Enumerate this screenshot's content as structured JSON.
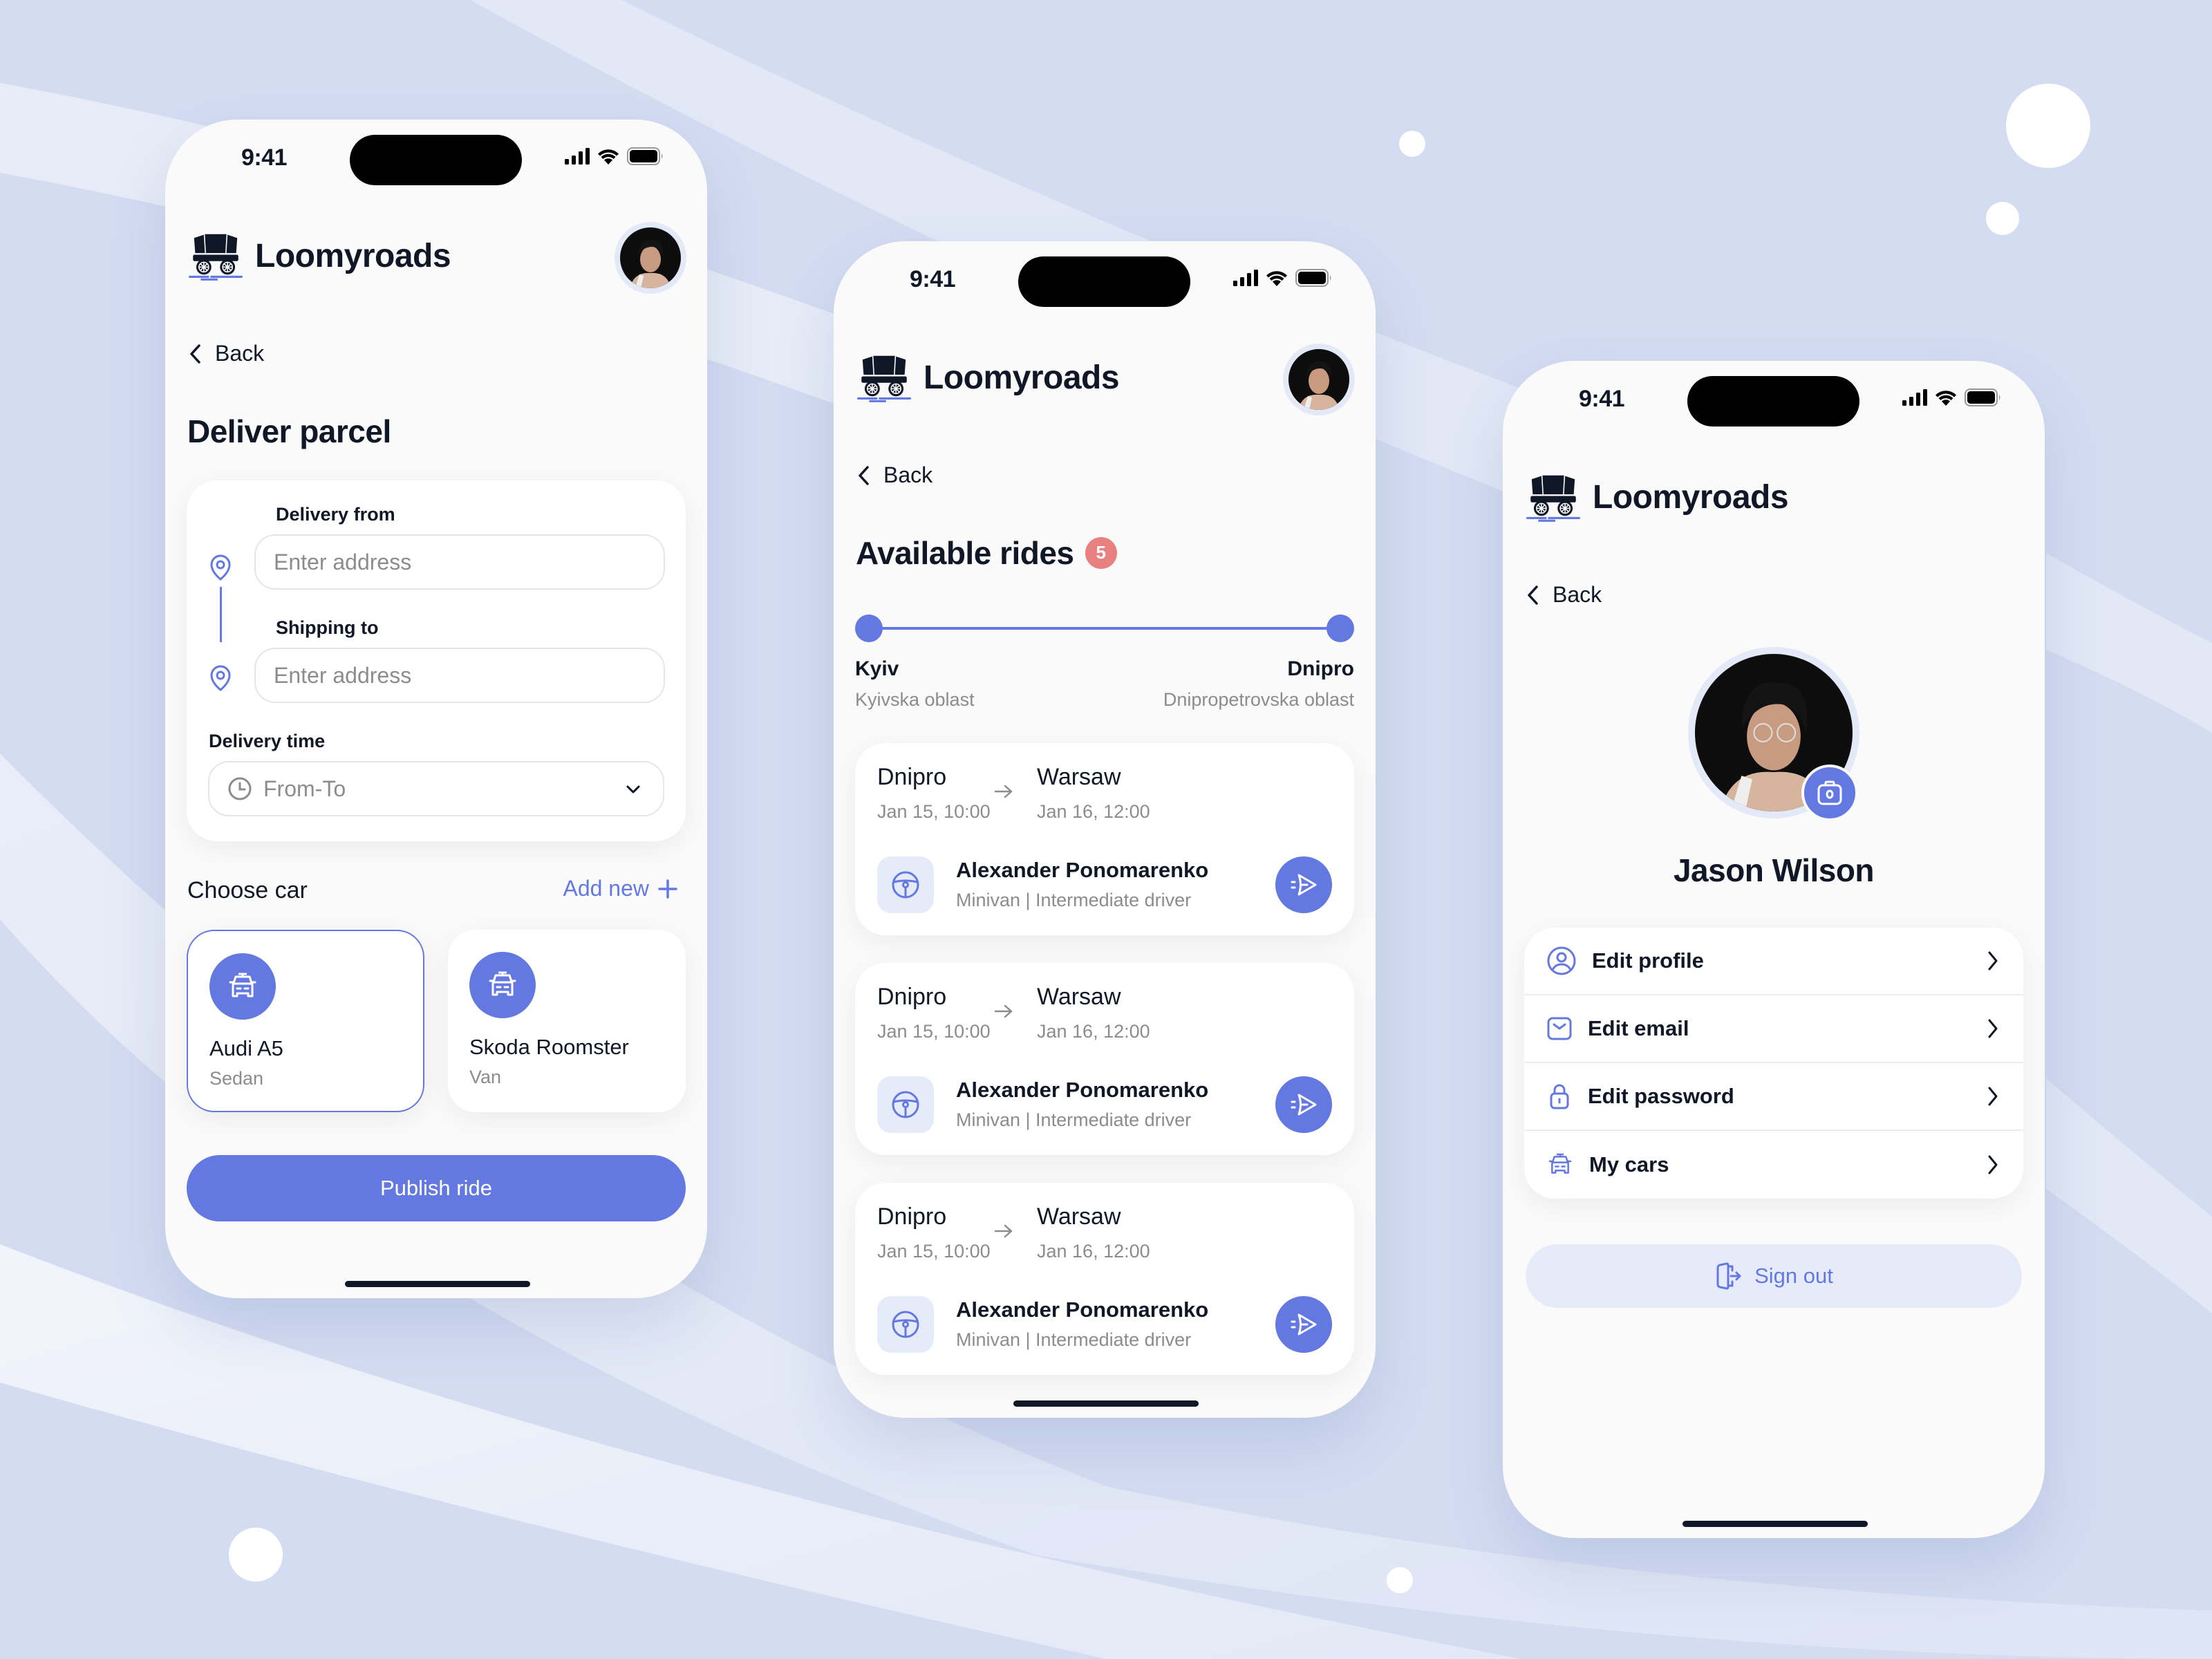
{
  "theme": {
    "accent": "#6378E0",
    "background": "#D3DCF1",
    "badge": "#E98080",
    "text": "#101828",
    "muted": "#8C8C90"
  },
  "status_bar": {
    "time": "9:41",
    "icons": [
      "cellular-signal-icon",
      "wifi-icon",
      "battery-icon"
    ]
  },
  "brand": {
    "name": "Loomyroads",
    "logo": "wagon-logo-icon"
  },
  "screens": {
    "deliver_parcel": {
      "back_label": "Back",
      "title": "Deliver parcel",
      "delivery_from": {
        "label": "Delivery from",
        "placeholder": "Enter address",
        "value": ""
      },
      "shipping_to": {
        "label": "Shipping to",
        "placeholder": "Enter address",
        "value": ""
      },
      "delivery_time": {
        "label": "Delivery time",
        "placeholder": "From-To"
      },
      "choose_car_label": "Choose car",
      "add_new_label": "Add new",
      "cars": [
        {
          "name": "Audi A5",
          "type": "Sedan",
          "selected": true
        },
        {
          "name": "Skoda Roomster",
          "type": "Van",
          "selected": false
        }
      ],
      "publish_label": "Publish ride"
    },
    "available_rides": {
      "back_label": "Back",
      "title": "Available rides",
      "count": "5",
      "route": {
        "from": {
          "city": "Kyiv",
          "region": "Kyivska oblast"
        },
        "to": {
          "city": "Dnipro",
          "region": "Dnipropetrovska oblast"
        }
      },
      "rides": [
        {
          "from": "Dnipro",
          "from_time": "Jan 15, 10:00",
          "to": "Warsaw",
          "to_time": "Jan 16, 12:00",
          "driver": "Alexander Ponomarenko",
          "meta": "Minivan | Intermediate driver"
        },
        {
          "from": "Dnipro",
          "from_time": "Jan 15, 10:00",
          "to": "Warsaw",
          "to_time": "Jan 16, 12:00",
          "driver": "Alexander Ponomarenko",
          "meta": "Minivan | Intermediate driver"
        },
        {
          "from": "Dnipro",
          "from_time": "Jan 15, 10:00",
          "to": "Warsaw",
          "to_time": "Jan 16, 12:00",
          "driver": "Alexander Ponomarenko",
          "meta": "Minivan | Intermediate driver"
        }
      ]
    },
    "profile": {
      "back_label": "Back",
      "name": "Jason Wilson",
      "menu": [
        {
          "label": "Edit profile",
          "icon": "user-circle-icon"
        },
        {
          "label": "Edit email",
          "icon": "mail-icon"
        },
        {
          "label": "Edit password",
          "icon": "lock-icon"
        },
        {
          "label": "My cars",
          "icon": "car-icon"
        }
      ],
      "sign_out_label": "Sign out"
    }
  }
}
